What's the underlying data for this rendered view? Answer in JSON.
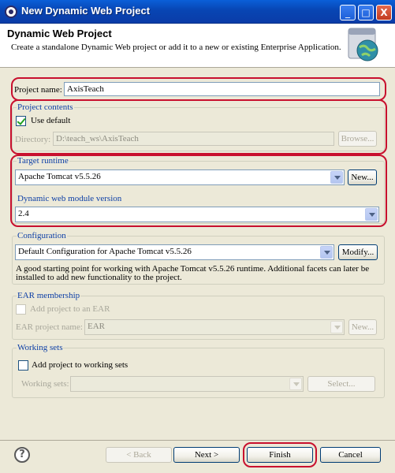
{
  "window": {
    "title": "New Dynamic Web Project",
    "controls": {
      "minimize": "_",
      "maximize": "□",
      "close": "X"
    }
  },
  "header": {
    "title": "Dynamic Web Project",
    "description": "Create a standalone Dynamic Web project or add it to a new or existing Enterprise Application.",
    "icon": "web-project-wizard-icon"
  },
  "project_name": {
    "label": "Project name:",
    "value": "AxisTeach"
  },
  "project_contents": {
    "group_title": "Project contents",
    "use_default_label": "Use default",
    "use_default_checked": true,
    "directory_label": "Directory:",
    "directory_value": "D:\\teach_ws\\AxisTeach",
    "browse_label": "Browse..."
  },
  "target_runtime": {
    "group_title": "Target runtime",
    "value": "Apache Tomcat v5.5.26",
    "new_label": "New...",
    "module_version_title": "Dynamic web module version",
    "module_version_value": "2.4"
  },
  "configuration": {
    "group_title": "Configuration",
    "value": "Default Configuration for Apache Tomcat v5.5.26",
    "modify_label": "Modify...",
    "description_line1": "A good starting point for working with Apache Tomcat v5.5.26 runtime. Additional facets can later be",
    "description_line2": "installed to add new functionality to the project."
  },
  "ear_membership": {
    "group_title": "EAR membership",
    "add_label": "Add project to an EAR",
    "name_label": "EAR project name:",
    "name_value": "EAR",
    "new_label": "New..."
  },
  "working_sets": {
    "group_title": "Working sets",
    "add_label": "Add project to working sets",
    "sets_label": "Working sets:",
    "sets_value": "",
    "select_label": "Select..."
  },
  "footer": {
    "help": "?",
    "back_label": "< Back",
    "next_label": "Next >",
    "finish_label": "Finish",
    "cancel_label": "Cancel"
  },
  "colors": {
    "titlebar": "#0845b3",
    "group_title": "#0c3ea6",
    "highlight": "#c8102e",
    "background": "#ece9d8"
  }
}
